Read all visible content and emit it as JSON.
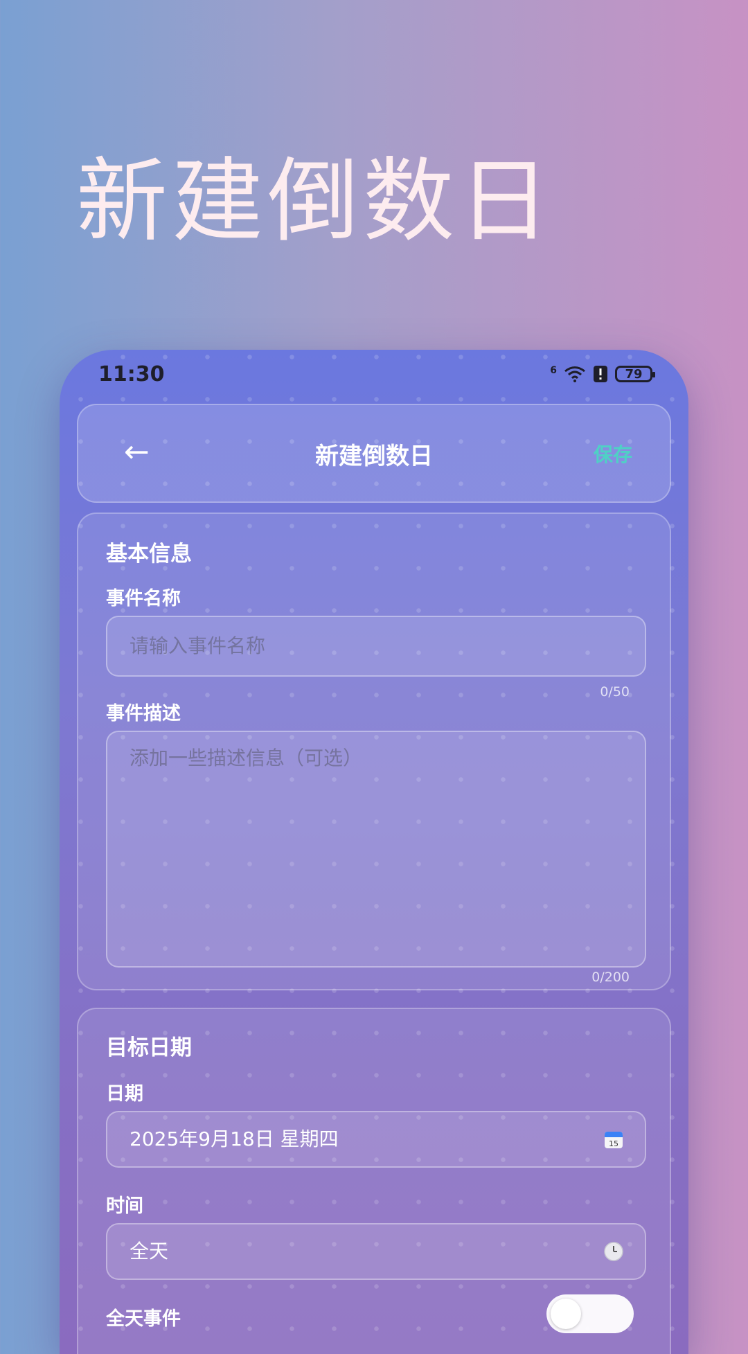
{
  "headline": "新建倒数日",
  "status_bar": {
    "time": "11:30",
    "battery": "79",
    "network": "6"
  },
  "app_bar": {
    "back": "←",
    "title": "新建倒数日",
    "save": "保存"
  },
  "basic_info": {
    "title": "基本信息",
    "name_label": "事件名称",
    "name_placeholder": "请输入事件名称",
    "name_counter": "0/50",
    "desc_label": "事件描述",
    "desc_placeholder": "添加一些描述信息（可选）",
    "desc_counter": "0/200"
  },
  "target_date": {
    "title": "目标日期",
    "date_label": "日期",
    "date_value": "2025年9月18日 星期四",
    "date_icon": "calendar-icon",
    "calendar_day": "15",
    "time_label": "时间",
    "time_value": "全天",
    "time_icon": "clock-icon",
    "all_day_label": "全天事件",
    "all_day_on": false
  },
  "colors": {
    "accent": "#4fd1c5"
  }
}
